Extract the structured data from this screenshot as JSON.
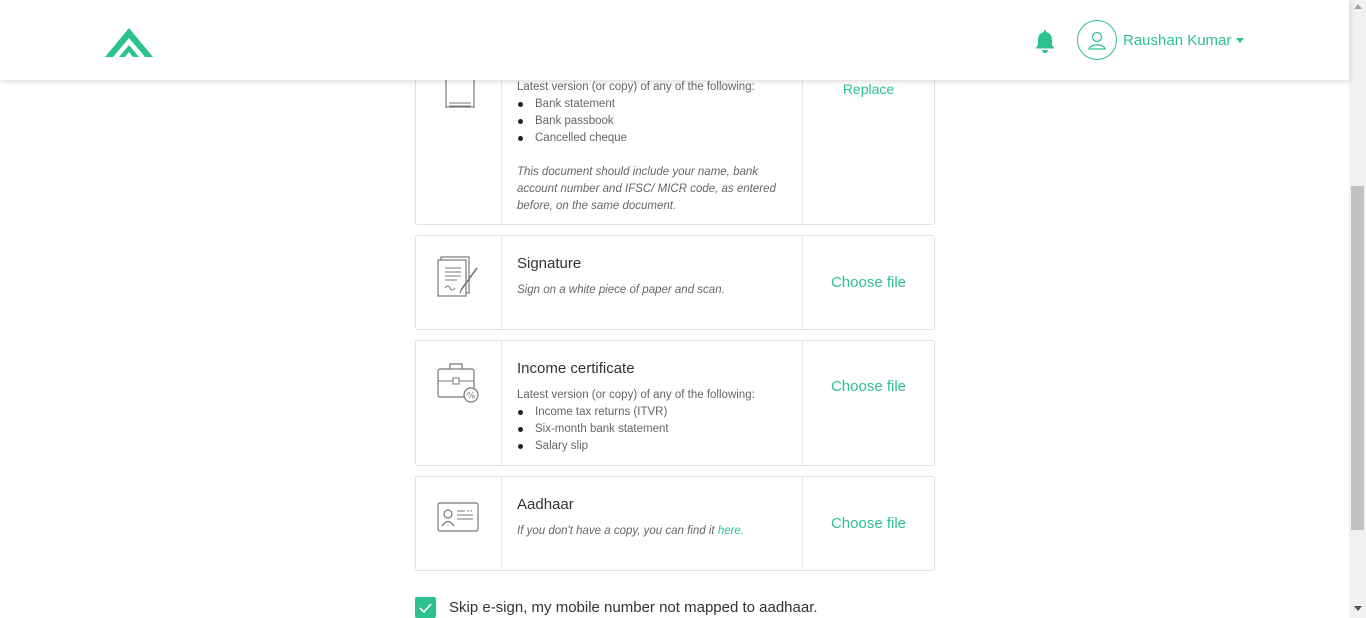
{
  "header": {
    "user_name": "Raushan Kumar"
  },
  "documents": {
    "bank": {
      "desc": "Latest version (or copy) of any of the following:",
      "bullets": [
        "Bank statement",
        "Bank passbook",
        "Cancelled cheque"
      ],
      "note": "This document should include your name, bank account number and IFSC/ MICR code, as entered before, on the same document.",
      "action": "Replace"
    },
    "signature": {
      "title": "Signature",
      "note": "Sign on a white piece of paper and scan.",
      "action": "Choose file"
    },
    "income": {
      "title": "Income certificate",
      "desc": "Latest version (or copy) of any of the following:",
      "bullets": [
        "Income tax returns (ITVR)",
        "Six-month bank statement",
        "Salary slip"
      ],
      "action": "Choose file"
    },
    "aadhaar": {
      "title": "Aadhaar",
      "note_prefix": "If you don't have a copy, you can find it ",
      "note_link": "here.",
      "action": "Choose file"
    }
  },
  "skip_esign": {
    "label": "Skip e-sign, my mobile number not mapped to aadhaar.",
    "checked": true
  },
  "colors": {
    "accent": "#2cc28e",
    "border": "#e2e2e2"
  },
  "icons": [
    "app-logo",
    "bell-icon",
    "user-icon",
    "caret-down-icon",
    "bank-document-icon",
    "signature-icon",
    "income-certificate-icon",
    "aadhaar-card-icon",
    "checkmark-icon"
  ]
}
